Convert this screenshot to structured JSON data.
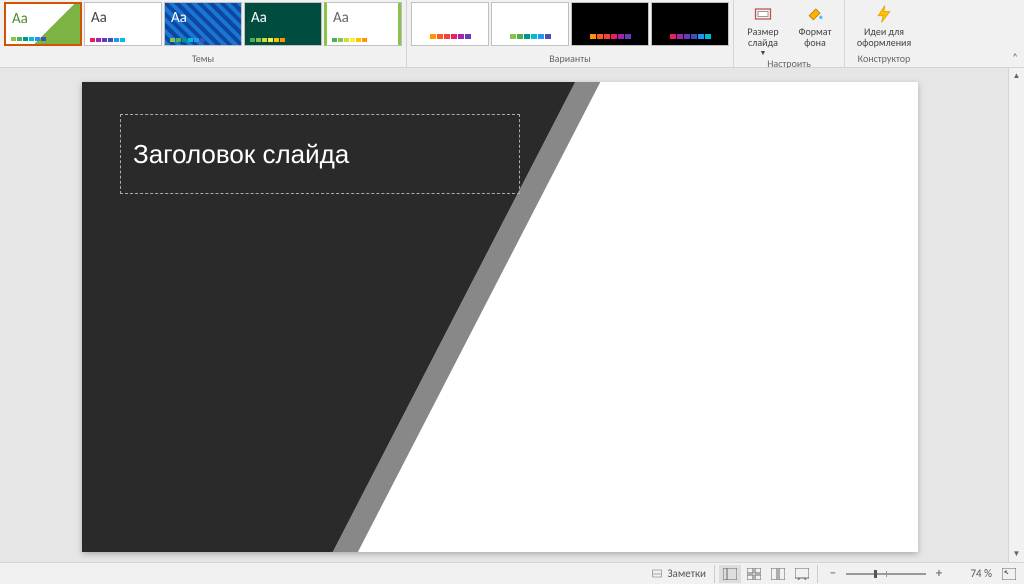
{
  "ribbon": {
    "themes": {
      "label": "Темы",
      "items": [
        {
          "aa": "Aa",
          "aa_color": "#558b2f",
          "cls": "th1 selected",
          "sw": "sw-a"
        },
        {
          "aa": "Aa",
          "aa_color": "#444",
          "cls": "th2",
          "sw": "sw-b"
        },
        {
          "aa": "Aa",
          "aa_color": "#fff",
          "cls": "th3",
          "sw": "sw-a"
        },
        {
          "aa": "Aa",
          "aa_color": "#fff",
          "cls": "th4",
          "sw": "sw-d"
        },
        {
          "aa": "Aa",
          "aa_color": "#666",
          "cls": "th5",
          "sw": "sw-d"
        }
      ]
    },
    "variants": {
      "label": "Варианты",
      "items": [
        {
          "dark": false,
          "sw": "sw-c"
        },
        {
          "dark": false,
          "sw": "sw-a"
        },
        {
          "dark": true,
          "sw": "sw-c"
        },
        {
          "dark": true,
          "sw": "sw-b"
        }
      ]
    },
    "customize": {
      "label": "Настроить",
      "size": "Размер слайда",
      "format": "Формат фона"
    },
    "designer": {
      "label": "Конструктор",
      "ideas": "Идеи для оформления"
    }
  },
  "slide": {
    "title_placeholder": "Заголовок слайда"
  },
  "statusbar": {
    "notes": "Заметки",
    "zoom_pct": "74 %"
  }
}
